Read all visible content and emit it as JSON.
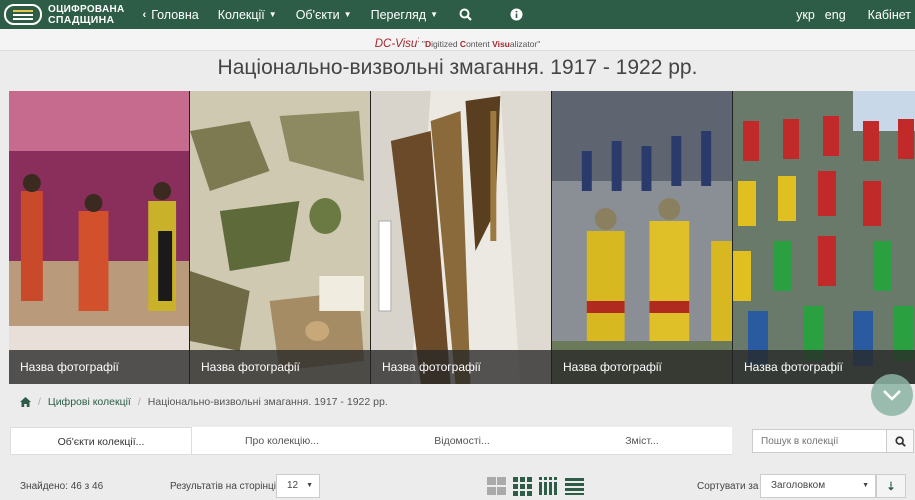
{
  "nav": {
    "logo_line1": "ОЦИФРОВАНА",
    "logo_line2": "СПАДЩИНА",
    "home": "Головна",
    "collections": "Колекції",
    "objects": "Об'єкти",
    "view": "Перегляд",
    "lang_uk": "укр",
    "lang_en": "eng",
    "cabinet": "Кабінет",
    "brand_color": "#2d5d46"
  },
  "dcvisu": {
    "name": "DC-Visu",
    "colon": ":",
    "desc_open": " \"",
    "d": "D",
    "d_rest": "igitized ",
    "c": "C",
    "c_rest": "ontent ",
    "v": "Visu",
    "v_rest": "alizator\""
  },
  "page_title": "Національно-визвольні змагання. 1917 - 1922 рр.",
  "gallery": [
    {
      "caption": "Назва фотографії"
    },
    {
      "caption": "Назва фотографії"
    },
    {
      "caption": "Назва фотографії"
    },
    {
      "caption": "Назва фотографії"
    },
    {
      "caption": "Назва фотографії"
    }
  ],
  "breadcrumb": {
    "level1": "Цифрові колекції",
    "level2": "Національно-визвольні змагання. 1917 - 1922 рр."
  },
  "tabs": [
    {
      "label": "Об'єкти колекції..."
    },
    {
      "label": "Про колекцію..."
    },
    {
      "label": "Відомості..."
    },
    {
      "label": "Зміст..."
    }
  ],
  "search": {
    "placeholder": "Пошук в колекції"
  },
  "results": {
    "found": "Знайдено: 46 з 46",
    "per_page_label": "Результатів на сторінці",
    "per_page_value": "12",
    "sort_label": "Сортувати за",
    "sort_value": "Заголовком"
  }
}
